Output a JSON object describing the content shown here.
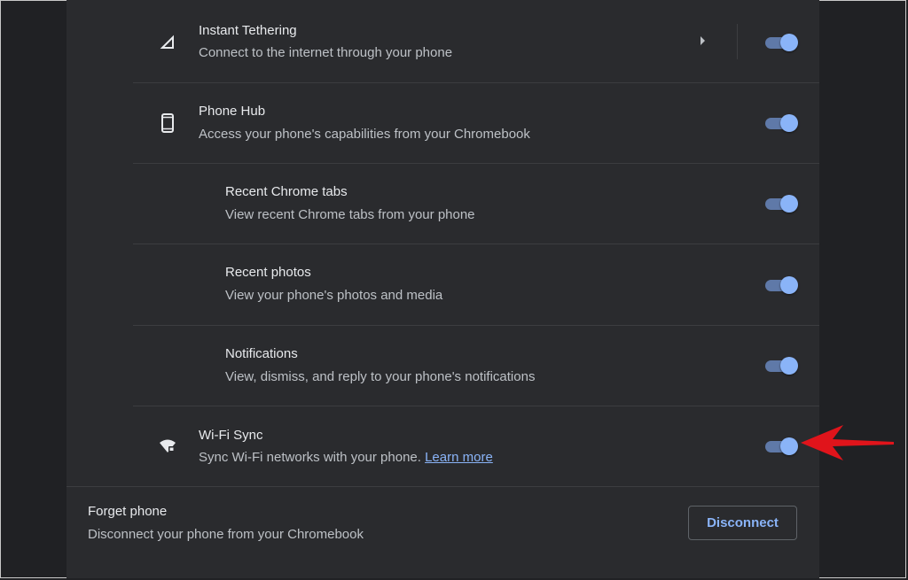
{
  "settings": [
    {
      "id": "instant-tethering",
      "title": "Instant Tethering",
      "subtitle": "Connect to the internet through your phone",
      "icon": "signal-icon",
      "enabled": true,
      "has_subpage": true
    },
    {
      "id": "phone-hub",
      "title": "Phone Hub",
      "subtitle": "Access your phone's capabilities from your Chromebook",
      "icon": "smartphone-icon",
      "enabled": true
    },
    {
      "id": "recent-chrome-tabs",
      "title": "Recent Chrome tabs",
      "subtitle": "View recent Chrome tabs from your phone",
      "enabled": true
    },
    {
      "id": "recent-photos",
      "title": "Recent photos",
      "subtitle": "View your phone's photos and media",
      "enabled": true
    },
    {
      "id": "notifications",
      "title": "Notifications",
      "subtitle": "View, dismiss, and reply to your phone's notifications",
      "enabled": true
    },
    {
      "id": "wifi-sync",
      "title": "Wi-Fi Sync",
      "subtitle": "Sync Wi-Fi networks with your phone.",
      "link": "Learn more",
      "icon": "wifi-lock-icon",
      "enabled": true
    }
  ],
  "forget": {
    "title": "Forget phone",
    "subtitle": "Disconnect your phone from your Chromebook",
    "button": "Disconnect"
  },
  "annotation": {
    "icon": "red-arrow-icon",
    "color": "#e0141b"
  },
  "colors": {
    "accent": "#8ab4f8",
    "track": "#5f79a8",
    "background": "#202124",
    "panel": "#2a2b2e"
  }
}
